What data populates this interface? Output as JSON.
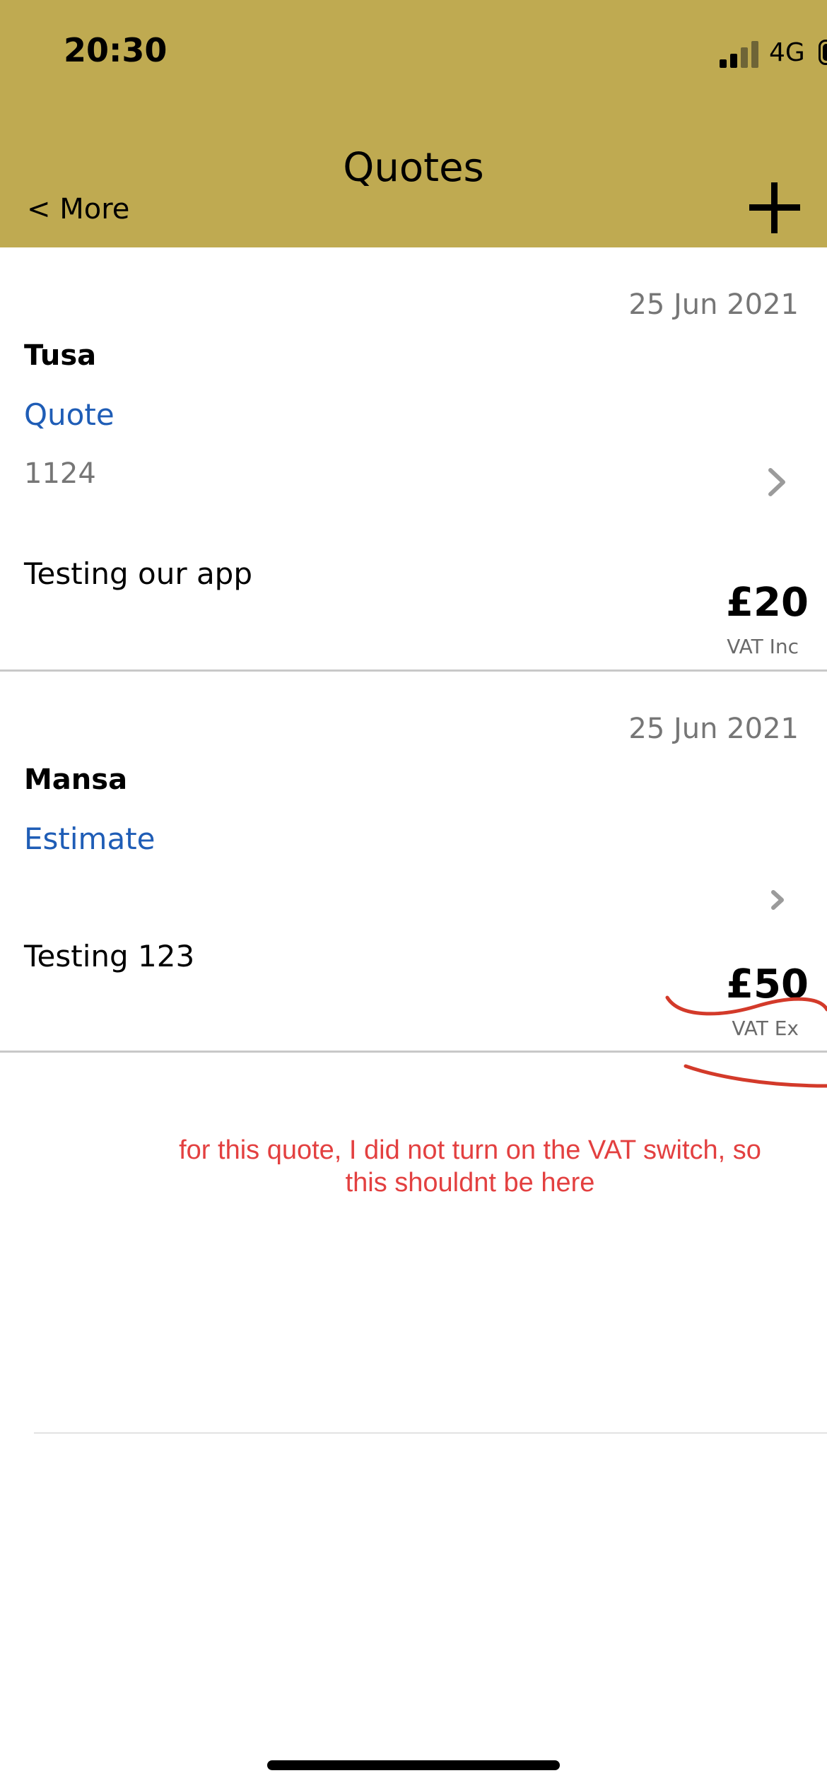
{
  "status_bar": {
    "time": "20:30",
    "network": "4G"
  },
  "header": {
    "title": "Quotes",
    "back_label": "< More",
    "background_color": "#bfaa51"
  },
  "quotes": [
    {
      "date": "25 Jun 2021",
      "client": "Tusa",
      "type": "Quote",
      "number": "1124",
      "description": "Testing our app",
      "amount": "£20",
      "vat_label": "VAT Inc"
    },
    {
      "date": "25 Jun 2021",
      "client": "Mansa",
      "type": "Estimate",
      "number": "",
      "description": "Testing 123",
      "amount": "£50",
      "vat_label": "VAT Ex"
    }
  ],
  "annotation": {
    "line1": "for this quote, I did not turn on the VAT switch, so",
    "line2": "this shouldnt be here",
    "color": "#e34040"
  },
  "colors": {
    "link_blue": "#1f5db6",
    "muted_gray": "#767676"
  }
}
